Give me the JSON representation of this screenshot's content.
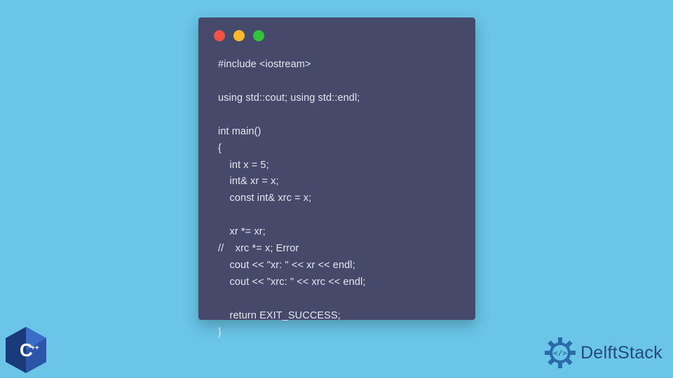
{
  "window": {
    "lights": [
      "red",
      "yellow",
      "green"
    ]
  },
  "code": {
    "line1": "#include <iostream>",
    "line2": "",
    "line3": "using std::cout; using std::endl;",
    "line4": "",
    "line5": "int main()",
    "line6": "{",
    "line7": "    int x = 5;",
    "line8": "    int& xr = x;",
    "line9": "    const int& xrc = x;",
    "line10": "",
    "line11": "    xr *= xr;",
    "line12": "//    xrc *= x; Error",
    "line13": "    cout << \"xr: \" << xr << endl;",
    "line14": "    cout << \"xrc: \" << xrc << endl;",
    "line15": "",
    "line16": "    return EXIT_SUCCESS;",
    "line17": "}"
  },
  "badge": {
    "language": "C",
    "plus": "++"
  },
  "brand": {
    "name_part1": "Delft",
    "name_part2": "Stack"
  }
}
